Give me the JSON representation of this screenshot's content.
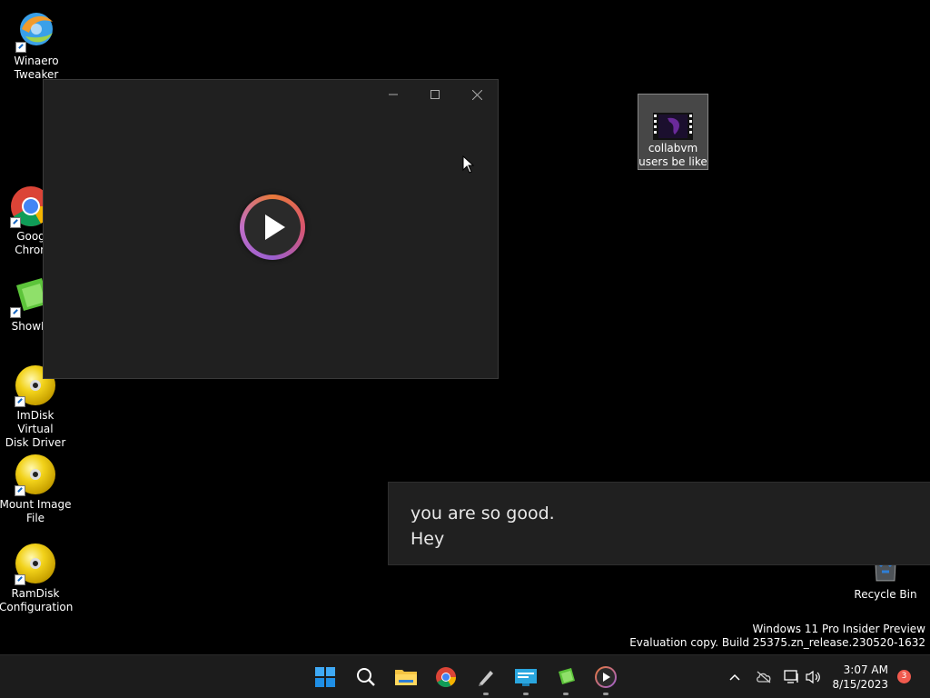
{
  "desktop_icons": [
    {
      "label_line1": "Winaero",
      "label_line2": "Tweaker",
      "icon": "winaero-icon"
    },
    {
      "label_line1": "Goog",
      "label_line2": "Chron",
      "icon": "chrome-icon"
    },
    {
      "label_line1": "ShowM",
      "label_line2": "",
      "icon": "showmore-icon"
    },
    {
      "label_line1": "ImDisk Virtual",
      "label_line2": "Disk Driver",
      "icon": "imdisk-icon"
    },
    {
      "label_line1": "Mount Image",
      "label_line2": "File",
      "icon": "mount-image-icon"
    },
    {
      "label_line1": "RamDisk",
      "label_line2": "Configuration",
      "icon": "ramdisk-icon"
    }
  ],
  "selected_file": {
    "label_line1": "collabvm",
    "label_line2": "users be like",
    "icon": "video-file-icon"
  },
  "recycle_bin": {
    "label": "Recycle Bin",
    "icon": "recycle-bin-icon"
  },
  "player_window": {
    "controls": [
      "minimize-icon",
      "maximize-icon",
      "close-icon"
    ],
    "center_icon": "play-icon"
  },
  "caption": {
    "line1": "you are so good.",
    "line2": "Hey"
  },
  "watermark": {
    "line1": "Windows 11 Pro Insider Preview",
    "line2": "Evaluation copy. Build 25375.zn_release.230520-1632"
  },
  "taskbar": {
    "items": [
      "start-icon",
      "search-icon",
      "file-explorer-icon",
      "chrome-icon",
      "pen-tool-icon",
      "remote-desktop-icon",
      "showmore-icon",
      "media-player-icon"
    ],
    "tray": [
      "chevron-up-icon",
      "cloud-offline-icon",
      "network-icon",
      "volume-icon"
    ],
    "time": "3:07 AM",
    "date": "8/15/2023",
    "notification_count": "3"
  },
  "colors": {
    "desktop_bg": "#000000",
    "window_bg": "#202020",
    "taskbar_bg": "#1c1c1c",
    "badge": "#f05a4e",
    "accent_blue": "#0a84ff"
  }
}
